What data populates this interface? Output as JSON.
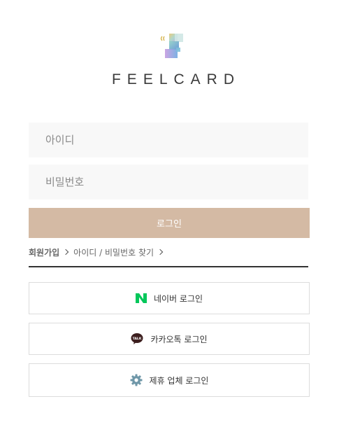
{
  "brand": {
    "name": "FEELCARD",
    "logo_icon": "feelcard-logo-mark"
  },
  "form": {
    "id_placeholder": "아이디",
    "password_placeholder": "비밀번호",
    "login_label": "로그인"
  },
  "links": {
    "signup": "회원가입",
    "find": "아이디 / 비밀번호 찾기"
  },
  "social": {
    "naver": {
      "label": "네이버 로그인",
      "icon": "naver-icon",
      "color": "#03c75a"
    },
    "kakao": {
      "label": "카카오톡 로그인",
      "icon": "kakao-talk-icon",
      "color": "#3c1e1e"
    },
    "partner": {
      "label": "제휴 업체 로그인",
      "icon": "gear-icon",
      "color": "#6f97a8"
    }
  },
  "colors": {
    "login_button": "#d4baa4",
    "field_bg": "#f8f8f8",
    "divider": "#333333"
  }
}
